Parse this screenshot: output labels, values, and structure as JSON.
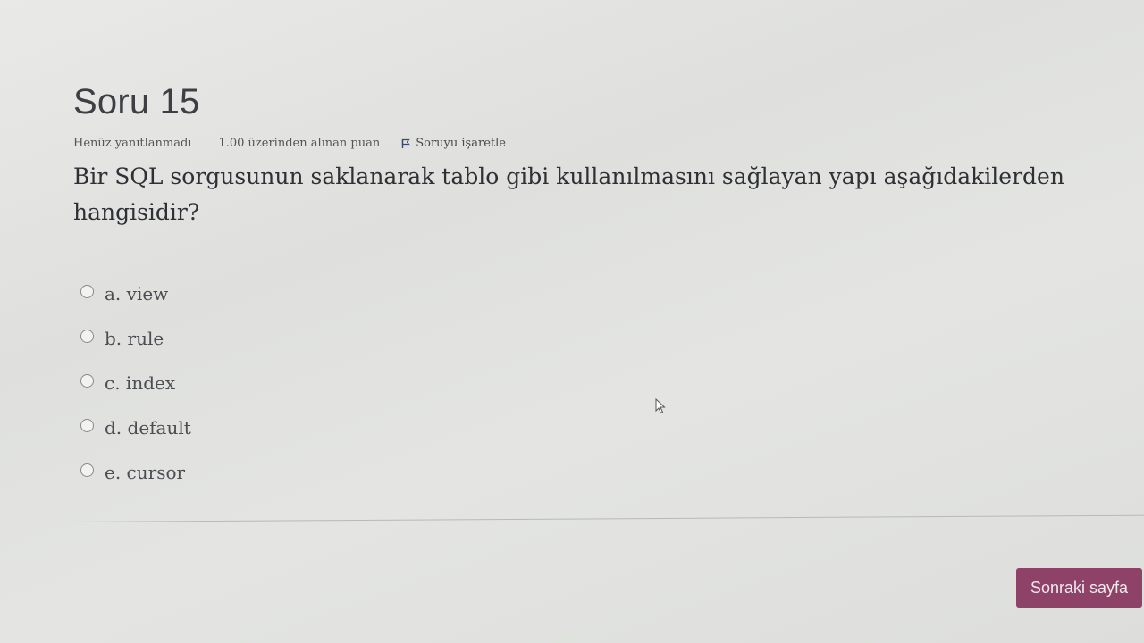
{
  "question": {
    "title": "Soru 15",
    "state": "Henüz yanıtlanmadı",
    "grade": "1.00 üzerinden alınan puan",
    "flag_label": "Soruyu işaretle",
    "text": "Bir SQL sorgusunun saklanarak tablo gibi kullanılmasını sağlayan yapı aşağıdakilerden hangisidir?"
  },
  "answers": [
    {
      "label": "a. view"
    },
    {
      "label": "b. rule"
    },
    {
      "label": "c. index"
    },
    {
      "label": "d. default"
    },
    {
      "label": "e. cursor"
    }
  ],
  "navigation": {
    "next_label": "Sonraki sayfa"
  },
  "colors": {
    "primary_button": "#8f4267",
    "title_text": "#3d3f44"
  }
}
